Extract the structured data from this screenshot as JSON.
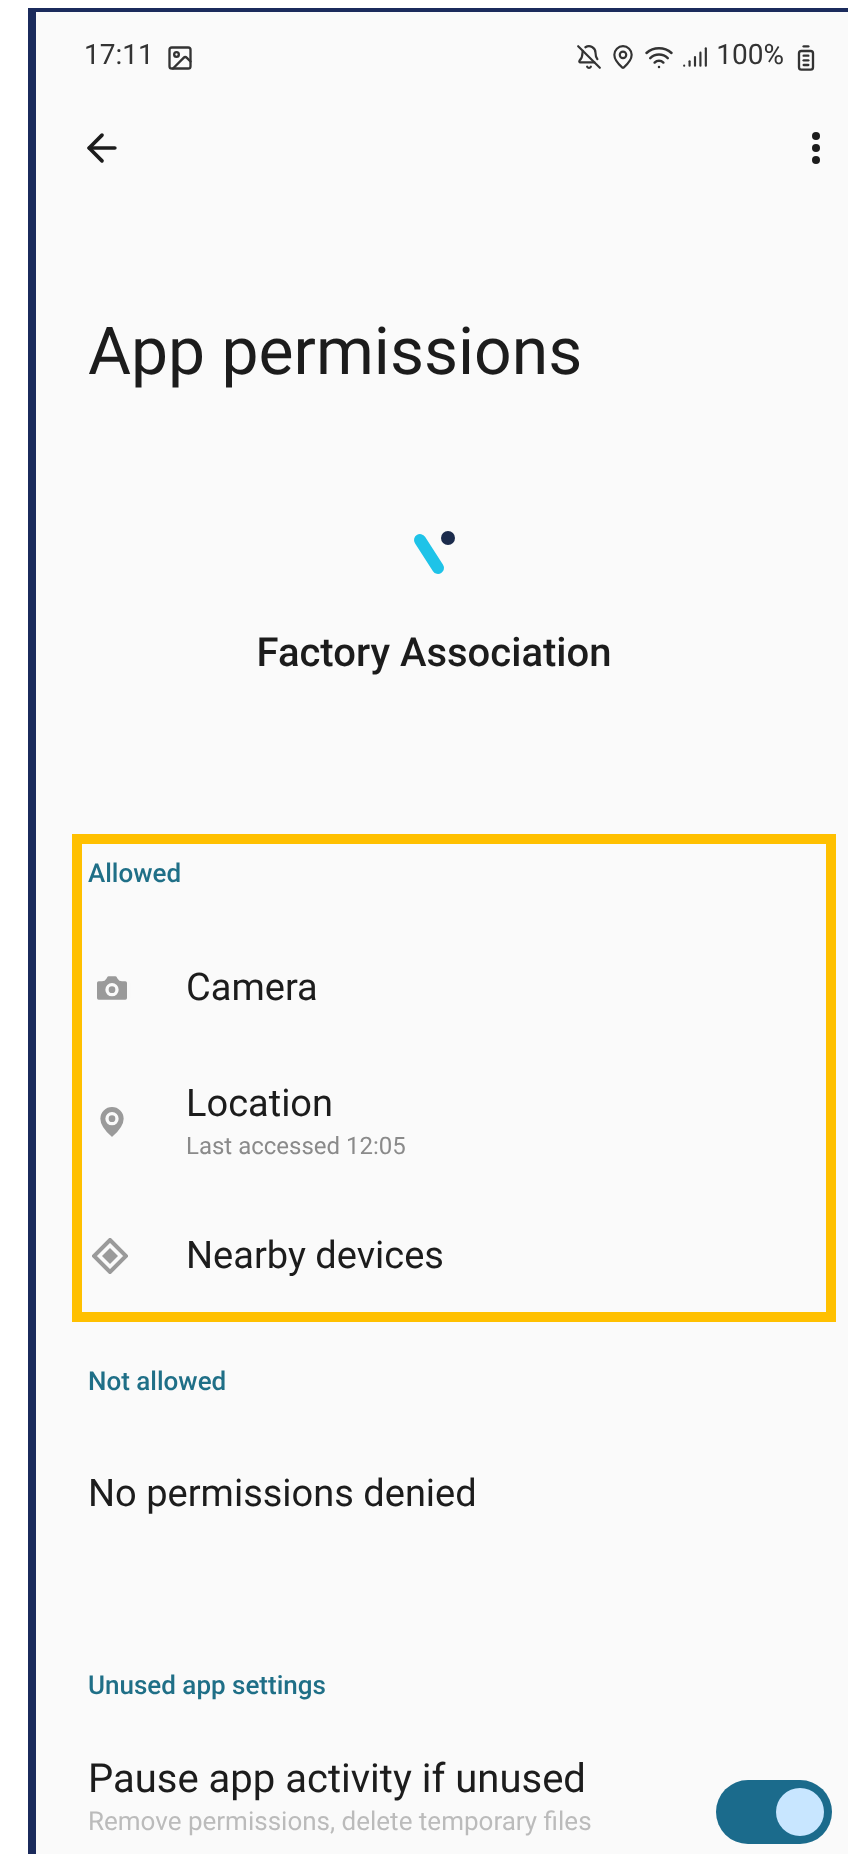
{
  "status_bar": {
    "time": "17:11",
    "battery": "100%"
  },
  "title": "App permissions",
  "app": {
    "name": "Factory Association"
  },
  "sections": [
    {
      "header": "Allowed",
      "highlighted": true,
      "items": [
        {
          "kind": "camera",
          "label": "Camera"
        },
        {
          "kind": "location",
          "label": "Location",
          "subtitle": "Last accessed 12:05"
        },
        {
          "kind": "nearby",
          "label": "Nearby devices"
        }
      ]
    },
    {
      "header": "Not allowed",
      "highlighted": false,
      "items": [
        {
          "kind": "plain",
          "label": "No permissions denied"
        }
      ]
    }
  ],
  "unused_settings": {
    "header": "Unused app settings",
    "label": "Pause app activity if unused",
    "subtitle": "Remove permissions, delete temporary files",
    "on": true
  }
}
